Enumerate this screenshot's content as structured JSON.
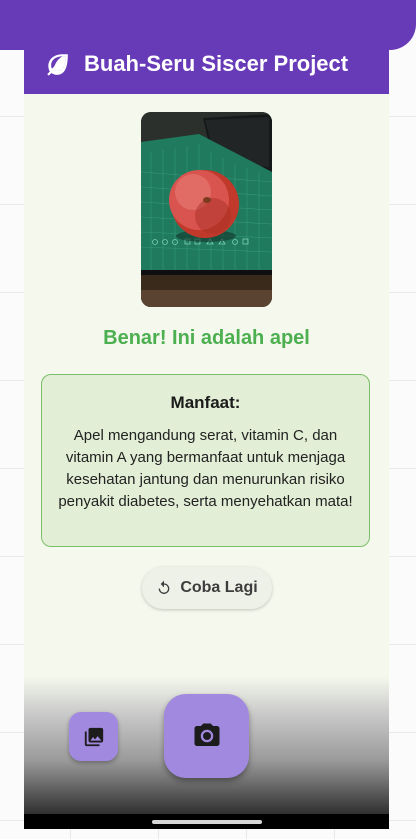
{
  "appbar": {
    "title": "Buah-Seru Siscer Project",
    "icon": "leaf-icon"
  },
  "photo": {
    "subject": "apple-on-cutting-mat"
  },
  "result": {
    "text": "Benar! Ini adalah apel",
    "color": "#4caf50"
  },
  "benefit_card": {
    "title": "Manfaat:",
    "body": "Apel mengandung serat, vitamin C, dan vitamin A yang bermanfaat untuk menjaga kesehatan jantung dan menurunkan risiko penyakit diabetes, serta menyehatkan mata!"
  },
  "retry_button": {
    "label": "Coba Lagi",
    "icon": "refresh-icon"
  },
  "actions": {
    "gallery_icon": "gallery-icon",
    "camera_icon": "camera-icon"
  },
  "colors": {
    "primary": "#673ab7",
    "fab": "#a289e0",
    "background": "#f5f9ed",
    "card": "#e2eed5"
  }
}
